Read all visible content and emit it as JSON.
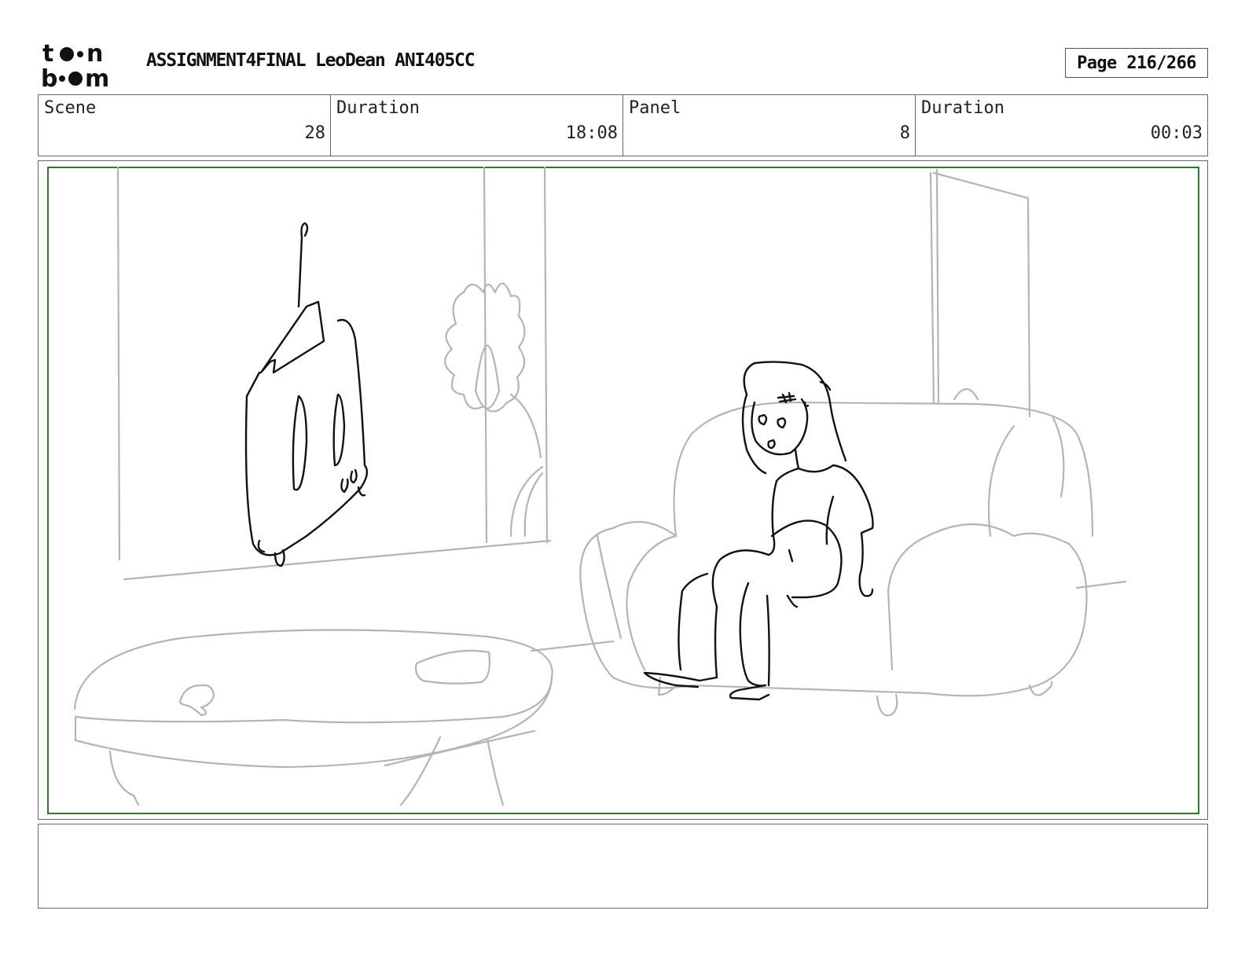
{
  "header": {
    "logo_text": "toon boom",
    "title": "ASSIGNMENT4FINAL LeoDean ANI405CC",
    "page": "Page 216/266"
  },
  "info": {
    "scene_label": "Scene",
    "scene_value": "28",
    "scene_duration_label": "Duration",
    "scene_duration_value": "18:08",
    "panel_label": "Panel",
    "panel_value": "8",
    "panel_duration_label": "Duration",
    "panel_duration_value": "00:03"
  },
  "notes": {
    "text": ""
  },
  "colors": {
    "safe_frame": "#2d7a2d",
    "sketch_line": "#b4b4b4",
    "ink_line": "#111111"
  }
}
